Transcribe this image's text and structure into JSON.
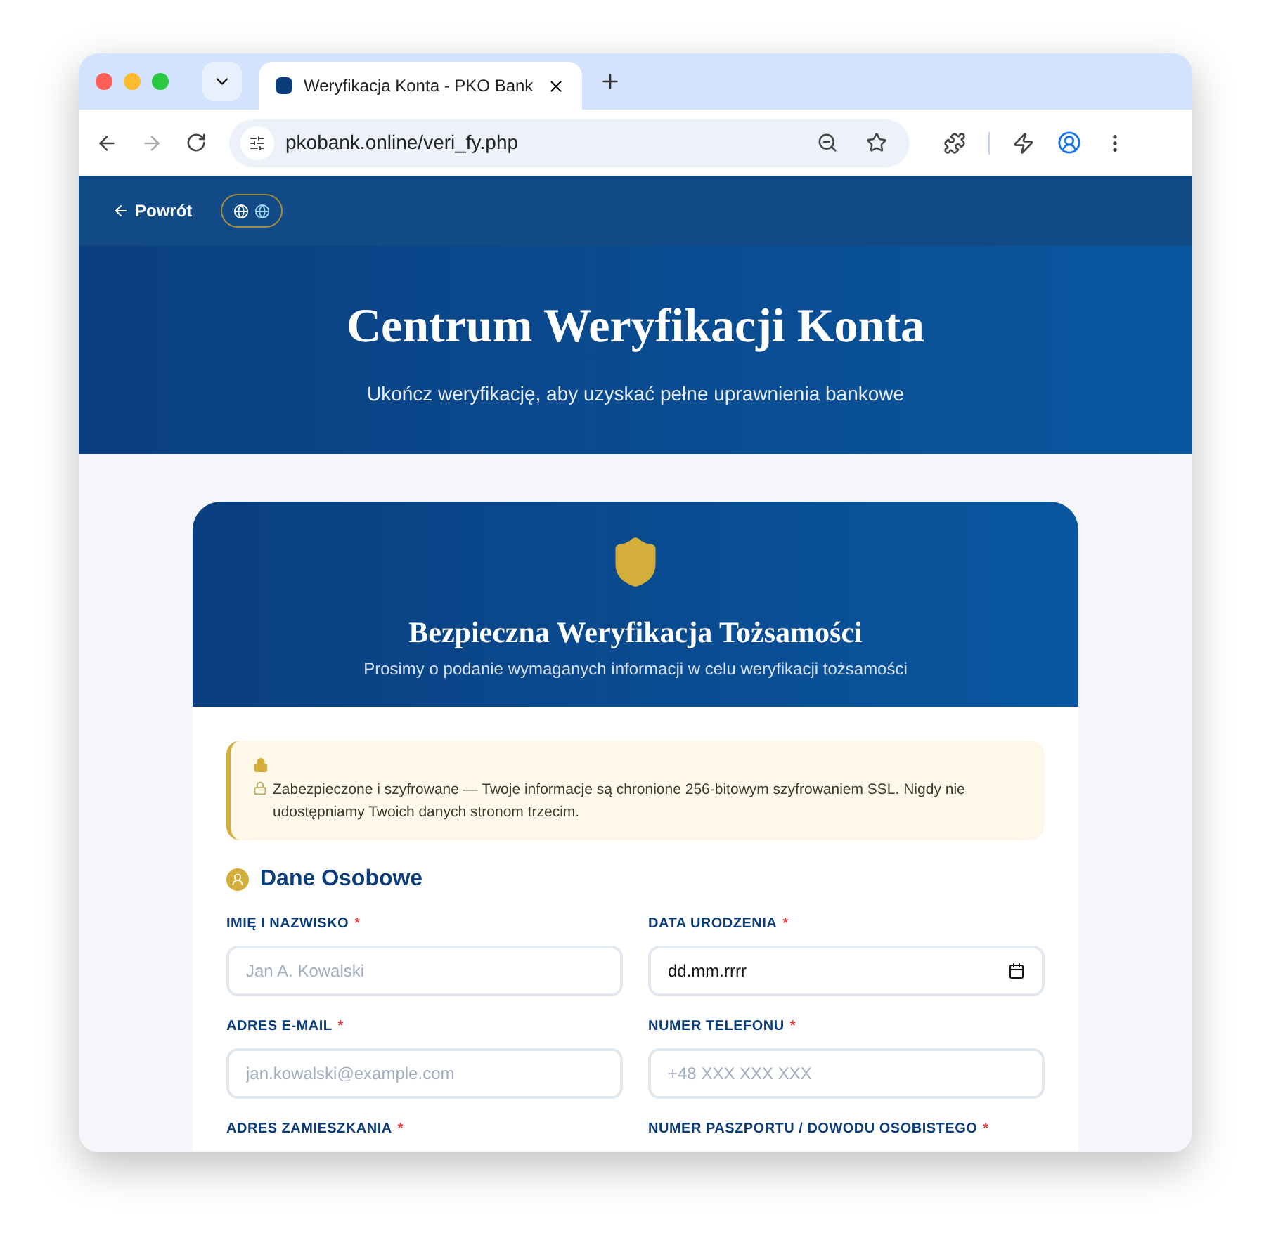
{
  "browser": {
    "tab": {
      "title": "Weryfikacja Konta - PKO Bank"
    },
    "address": "pkobank.online/veri_fy.php"
  },
  "nav": {
    "back_link": "Powrót",
    "language_options": [
      {
        "selected": false
      },
      {
        "selected": true
      }
    ]
  },
  "hero": {
    "title": "Centrum Weryfikacji Konta",
    "subtitle": "Ukończ weryfikację, aby uzyskać pełne uprawnienia bankowe"
  },
  "card": {
    "title": "Bezpieczna Weryfikacja Tożsamości",
    "subtitle": "Prosimy o podanie wymaganych informacji w celu weryfikacji tożsamości",
    "notice": "Zabezpieczone i szyfrowane — Twoje informacje są chronione 256-bitowym szyfrowaniem SSL. Nigdy nie udostępniamy Twoich danych stronom trzecim.",
    "section_title": "Dane Osobowe",
    "fields": [
      {
        "label": "IMIĘ I NAZWISKO",
        "required_mark": "*",
        "kind": "text",
        "placeholder": "Jan A. Kowalski"
      },
      {
        "label": "DATA URODZENIA",
        "required_mark": "*",
        "kind": "date",
        "placeholder": "dd.mm.rrrr"
      },
      {
        "label": "ADRES E-MAIL",
        "required_mark": "*",
        "kind": "text",
        "placeholder": "jan.kowalski@example.com"
      },
      {
        "label": "NUMER TELEFONU",
        "required_mark": "*",
        "kind": "text",
        "placeholder": "+48 XXX XXX XXX"
      },
      {
        "label": "ADRES ZAMIESZKANIA",
        "required_mark": "*",
        "kind": "none"
      },
      {
        "label": "NUMER PASZPORTU / DOWODU OSOBISTEGO",
        "required_mark": "*",
        "kind": "none"
      }
    ]
  }
}
